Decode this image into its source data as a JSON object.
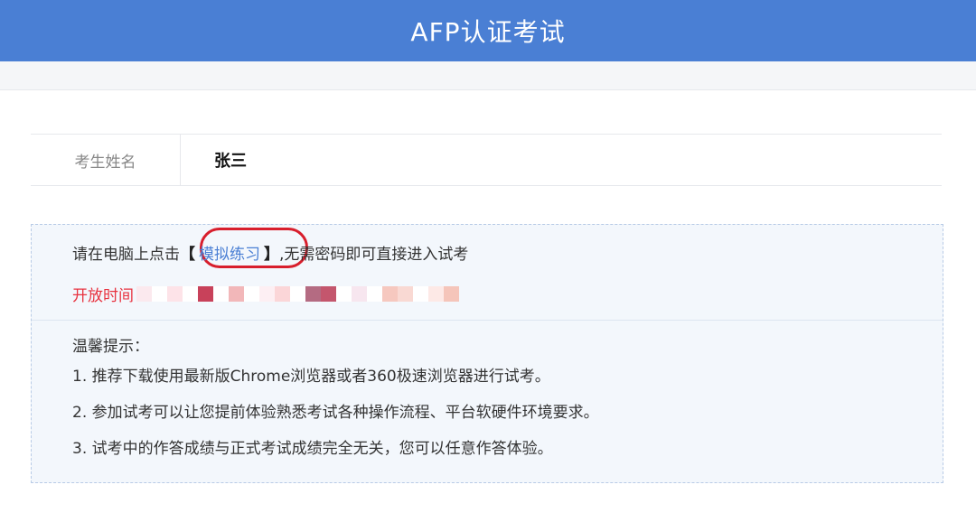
{
  "header": {
    "title": "AFP认证考试"
  },
  "candidate": {
    "label": "考生姓名",
    "name": "张三"
  },
  "notice": {
    "instruction_prefix": "请在电脑上点击",
    "bracket_open": "【",
    "practice_link": "模拟练习",
    "bracket_close": "】",
    "instruction_suffix": ",无需密码即可直接进入试考",
    "open_time_label": "开放时间",
    "highlight_color": "#d81e2c"
  },
  "tips": {
    "title": "温馨提示：",
    "items": [
      "1. 推荐下载使用最新版Chrome浏览器或者360极速浏览器进行试考。",
      "2. 参加试考可以让您提前体验熟悉考试各种操作流程、平台软硬件环境要求。",
      "3. 试考中的作答成绩与正式考试成绩完全无关，您可以任意作答体验。"
    ]
  },
  "colors": {
    "header_bg": "#4a7fd4",
    "link": "#4a7fd4",
    "open_time": "#e8323f"
  }
}
